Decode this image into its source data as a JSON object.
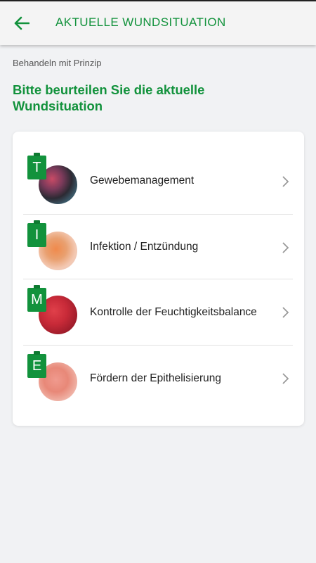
{
  "header": {
    "title": "AKTUELLE WUNDSITUATION",
    "back_icon": "arrow-left-icon"
  },
  "breadcrumb": "Behandeln mit Prinzip",
  "heading": "Bitte beurteilen Sie die aktuelle Wundsituation",
  "colors": {
    "accent": "#12923c",
    "background": "#f1f2f4"
  },
  "items": [
    {
      "letter": "T",
      "label": "Gewebemanagement"
    },
    {
      "letter": "I",
      "label": "Infektion / Entzündung"
    },
    {
      "letter": "M",
      "label": "Kontrolle der Feuchtigkeitsbalance"
    },
    {
      "letter": "E",
      "label": "Fördern der Epithelisierung"
    }
  ]
}
